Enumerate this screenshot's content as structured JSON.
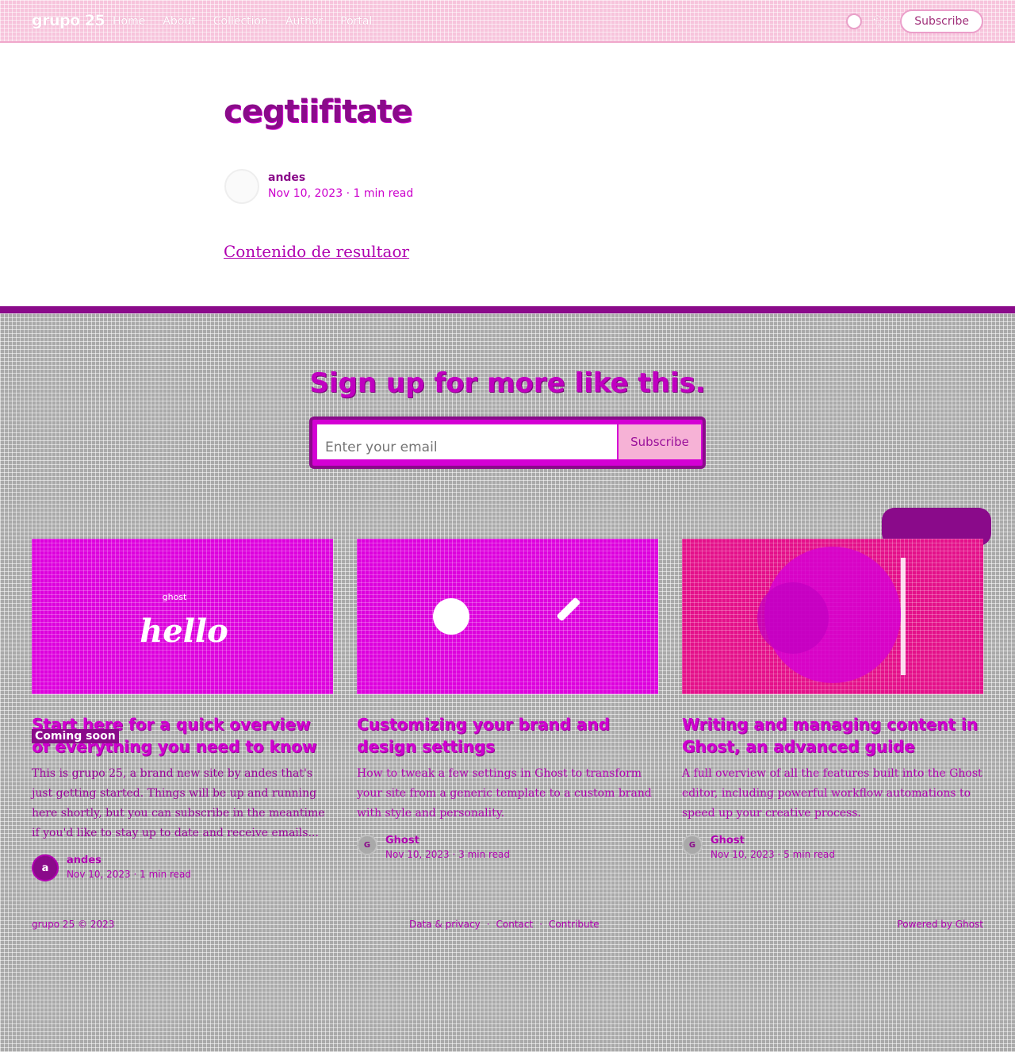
{
  "header": {
    "logo": "grupo 25",
    "nav": [
      "Home",
      "About",
      "Collection",
      "Author",
      "Portal"
    ],
    "subscribe_label": "Subscribe"
  },
  "article": {
    "title": "cegtiifitate",
    "author_name": "andes",
    "meta": "Nov 10, 2023 · 1 min read",
    "body": "Contenido de resultaor"
  },
  "signup": {
    "title": "Sign up for more like this.",
    "email_placeholder": "Enter your email",
    "button_label": "Subscribe"
  },
  "cards": [
    {
      "title": "Start here for a quick overview of everything you need to know",
      "excerpt": "This is grupo 25, a brand new site by andes that's just getting started. Things will be up and running here shortly, but you can subscribe in the meantime if you'd like to stay up to date and receive emails...",
      "author": "andes",
      "author_initial": "a",
      "meta": "Nov 10, 2023 · 1 min read",
      "image_text": "hello",
      "image_subtext": "ghost"
    },
    {
      "title": "Customizing your brand and design settings",
      "excerpt": "How to tweak a few settings in Ghost to transform your site from a generic template to a custom brand with style and personality.",
      "author": "Ghost",
      "author_initial": "G",
      "meta": "Nov 10, 2023 · 3 min read"
    },
    {
      "title": "Writing and managing content in Ghost, an advanced guide",
      "excerpt": "A full overview of all the features built into the Ghost editor, including powerful workflow automations to speed up your creative process.",
      "author": "Ghost",
      "author_initial": "G",
      "meta": "Nov 10, 2023 · 5 min read"
    }
  ],
  "badges": {
    "coming_soon": "Coming soon"
  },
  "footer": {
    "copyright": "grupo 25 © 2023",
    "links": [
      "Data & privacy",
      "Contact",
      "Contribute"
    ],
    "powered": "Powered by Ghost"
  },
  "colors": {
    "accent": "#d400d4",
    "accent_dark": "#8a0a8a",
    "header_bg": "#f7c4dc",
    "lower_bg": "#a9a9a9"
  }
}
